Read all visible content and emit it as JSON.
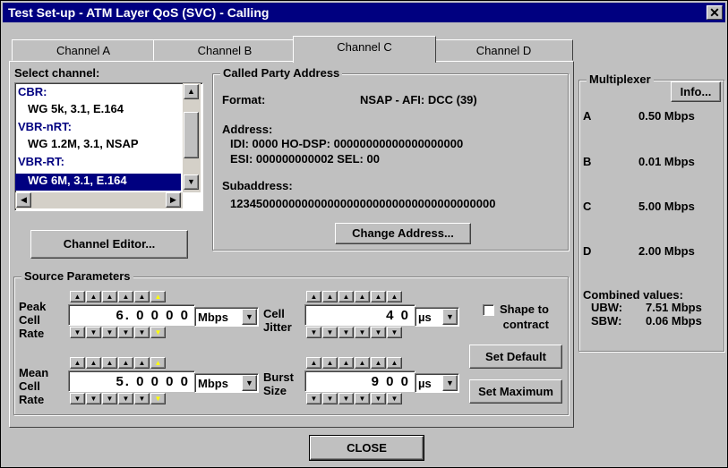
{
  "window": {
    "title": "Test Set-up - ATM Layer QoS (SVC) - Calling",
    "close_glyph": "✕"
  },
  "tabs": [
    "Channel A",
    "Channel B",
    "Channel C",
    "Channel D"
  ],
  "active_tab": "Channel C",
  "select_channel": {
    "label": "Select channel:",
    "items": [
      {
        "text": "CBR:",
        "kind": "category"
      },
      {
        "text": "WG 5k, 3.1, E.164",
        "kind": "item"
      },
      {
        "text": "VBR-nRT:",
        "kind": "category"
      },
      {
        "text": "WG 1.2M, 3.1, NSAP",
        "kind": "item"
      },
      {
        "text": "VBR-RT:",
        "kind": "category"
      },
      {
        "text": "WG 6M, 3.1, E.164",
        "kind": "item",
        "selected": true
      }
    ]
  },
  "channel_editor_label": "Channel Editor...",
  "called_party": {
    "title": "Called Party Address",
    "format_label": "Format:",
    "format_value": "NSAP - AFI:  DCC (39)",
    "address_label": "Address:",
    "address_line1": "IDI: 0000   HO-DSP: 00000000000000000000",
    "address_line2": "ESI: 000000000002   SEL: 00",
    "subaddress_label": "Subaddress:",
    "subaddress_value": "12345000000000000000000000000000000000000",
    "change_button": "Change Address..."
  },
  "source_params": {
    "title": "Source Parameters",
    "pcr_label": [
      "Peak",
      "Cell",
      "Rate"
    ],
    "pcr_value": "6. 0 0 0 0",
    "pcr_unit": "Mbps",
    "mcr_label": [
      "Mean",
      "Cell",
      "Rate"
    ],
    "mcr_value": "5. 0 0 0 0",
    "mcr_unit": "Mbps",
    "jitter_label": [
      "Cell",
      "Jitter"
    ],
    "jitter_value": "4 0",
    "jitter_unit": "µs",
    "burst_label": [
      "Burst",
      "Size"
    ],
    "burst_value": "9 0 0",
    "burst_unit": "µs",
    "shape_label": [
      "Shape to",
      "contract"
    ],
    "shape_checked": false,
    "set_default": "Set Default",
    "set_maximum": "Set Maximum"
  },
  "multiplexer": {
    "title": "Multiplexer",
    "info_button": "Info...",
    "channels": [
      {
        "name": "A",
        "rate": "0.50 Mbps"
      },
      {
        "name": "B",
        "rate": "0.01 Mbps"
      },
      {
        "name": "C",
        "rate": "5.00 Mbps"
      },
      {
        "name": "D",
        "rate": "2.00 Mbps"
      }
    ],
    "combined_label": "Combined values:",
    "ubw_label": "UBW:",
    "ubw_value": "7.51 Mbps",
    "sbw_label": "SBW:",
    "sbw_value": "0.06 Mbps"
  },
  "close_button": "CLOSE",
  "spinner": {
    "up": "▲",
    "down": "▼"
  }
}
